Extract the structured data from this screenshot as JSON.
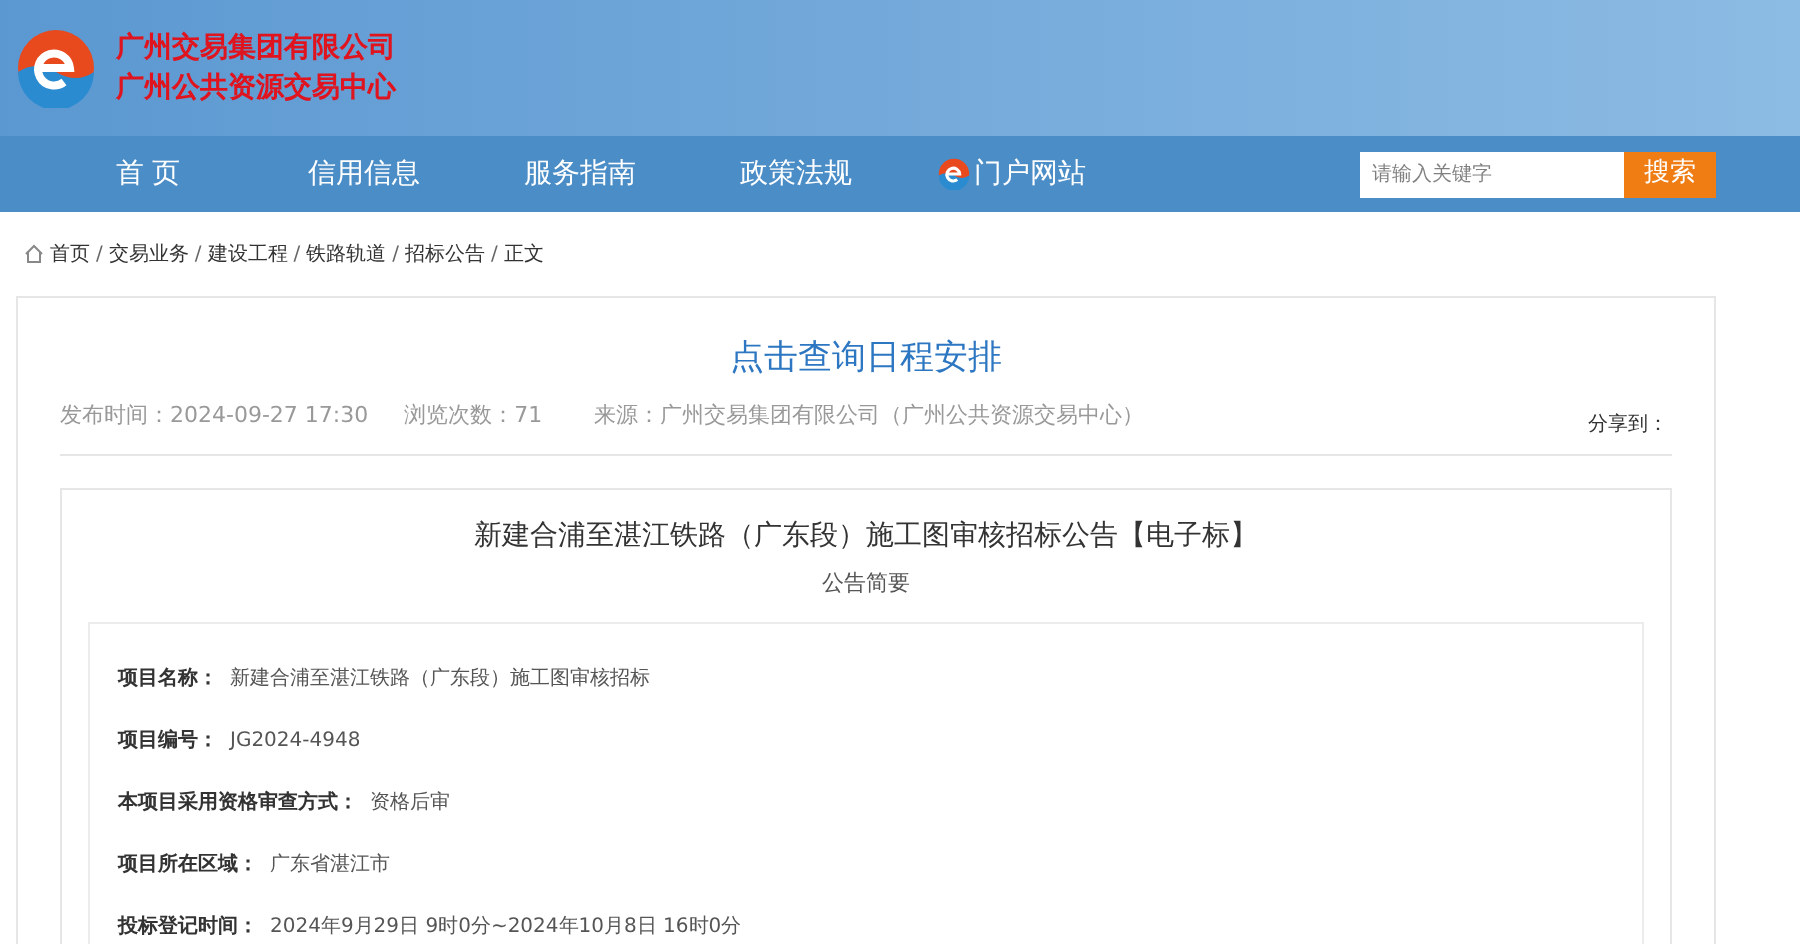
{
  "header": {
    "org_lines": [
      "广州交易集团有限公司",
      "广州公共资源交易中心"
    ]
  },
  "nav": {
    "items": [
      {
        "label": "首 页",
        "kind": "text"
      },
      {
        "label": "信用信息",
        "kind": "text"
      },
      {
        "label": "服务指南",
        "kind": "text"
      },
      {
        "label": "政策法规",
        "kind": "text"
      },
      {
        "label": "门户网站",
        "kind": "portal"
      }
    ],
    "search": {
      "placeholder": "请输入关键字",
      "button": "搜索"
    }
  },
  "breadcrumb": {
    "separator": "/",
    "items": [
      "首页",
      "交易业务",
      "建设工程",
      "铁路轨道",
      "招标公告",
      "正文"
    ]
  },
  "article": {
    "title": "点击查询日程安排",
    "meta": [
      "发布时间：2024-09-27 17:30",
      "浏览次数：71",
      "来源：广州交易集团有限公司（广州公共资源交易中心）"
    ],
    "share": "分享到：",
    "notice_title": "新建合浦至湛江铁路（广东段）施工图审核招标公告【电子标】",
    "subtitle": "公告简要",
    "fields": [
      {
        "label": "项目名称：",
        "value": "新建合浦至湛江铁路（广东段）施工图审核招标"
      },
      {
        "label": "项目编号：",
        "value": "JG2024-4948"
      },
      {
        "label": "本项目采用资格审查方式：",
        "value": "资格后审"
      },
      {
        "label": "项目所在区域：",
        "value": "广东省湛江市"
      },
      {
        "label": "投标登记时间：",
        "value": "2024年9月29日 9时0分~2024年10月8日 16时0分"
      }
    ]
  }
}
